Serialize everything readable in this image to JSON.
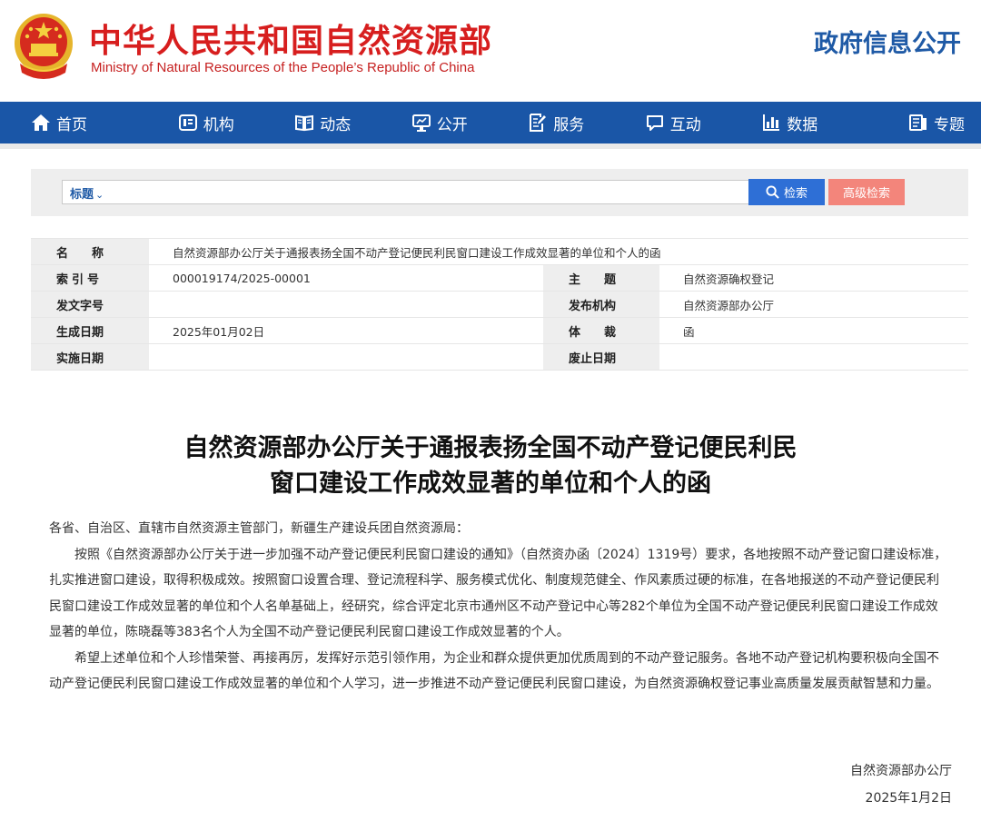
{
  "header": {
    "title_cn": "中华人民共和国自然资源部",
    "title_en": "Ministry of Natural Resources of the People’s Republic of China",
    "gov_info": "政府信息公开",
    "colors": {
      "brand_red": "#d71e1e",
      "brand_blue": "#1f5aa6"
    }
  },
  "nav": {
    "color": "#1a56a7",
    "items": [
      {
        "label": "首页",
        "icon": "home-icon"
      },
      {
        "label": "机构",
        "icon": "organization-icon"
      },
      {
        "label": "动态",
        "icon": "book-icon"
      },
      {
        "label": "公开",
        "icon": "monitor-icon"
      },
      {
        "label": "服务",
        "icon": "edit-document-icon"
      },
      {
        "label": "互动",
        "icon": "chat-icon"
      },
      {
        "label": "数据",
        "icon": "bar-chart-icon"
      },
      {
        "label": "专题",
        "icon": "topic-icon"
      }
    ]
  },
  "search": {
    "type_label": "标题",
    "query": "",
    "button_label": "检索",
    "advanced_label": "高级检索"
  },
  "meta": {
    "name_label": "名称",
    "name_value": "自然资源部办公厅关于通报表扬全国不动产登记便民利民窗口建设工作成效显著的单位和个人的函",
    "index_label": "索引号",
    "index_value": "000019174/2025-00001",
    "topic_label": "主题",
    "topic_value": "自然资源确权登记",
    "docno_label": "发文字号",
    "docno_value": "",
    "publisher_label": "发布机构",
    "publisher_value": "自然资源部办公厅",
    "created_label": "生成日期",
    "created_value": "2025年01月02日",
    "genre_label": "体裁",
    "genre_value": "函",
    "effective_label": "实施日期",
    "effective_value": "",
    "expire_label": "废止日期",
    "expire_value": ""
  },
  "article": {
    "title_line1": "自然资源部办公厅关于通报表扬全国不动产登记便民利民",
    "title_line2": "窗口建设工作成效显著的单位和个人的函",
    "salutation": "各省、自治区、直辖市自然资源主管部门，新疆生产建设兵团自然资源局：",
    "para1": "按照《自然资源部办公厅关于进一步加强不动产登记便民利民窗口建设的通知》（自然资办函〔2024〕1319号）要求，各地按照不动产登记窗口建设标准，扎实推进窗口建设，取得积极成效。按照窗口设置合理、登记流程科学、服务模式优化、制度规范健全、作风素质过硬的标准，在各地报送的不动产登记便民利民窗口建设工作成效显著的单位和个人名单基础上，经研究，综合评定北京市通州区不动产登记中心等282个单位为全国不动产登记便民利民窗口建设工作成效显著的单位，陈晓磊等383名个人为全国不动产登记便民利民窗口建设工作成效显著的个人。",
    "para2": "希望上述单位和个人珍惜荣誉、再接再厉，发挥好示范引领作用，为企业和群众提供更加优质周到的不动产登记服务。各地不动产登记机构要积极向全国不动产登记便民利民窗口建设工作成效显著的单位和个人学习，进一步推进不动产登记便民利民窗口建设，为自然资源确权登记事业高质量发展贡献智慧和力量。",
    "signature": "自然资源部办公厅",
    "date": "2025年1月2日"
  }
}
